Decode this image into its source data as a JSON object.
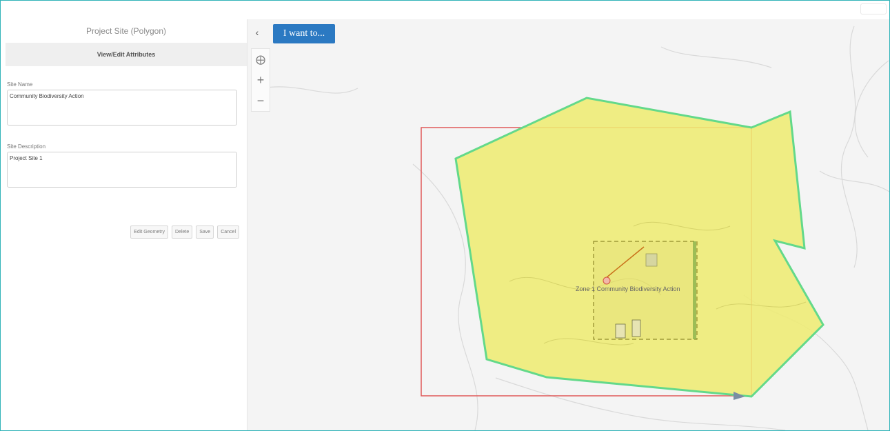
{
  "panel": {
    "title": "Project Site (Polygon)",
    "subheader": "View/Edit Attributes",
    "fields": [
      {
        "label": "Site Name",
        "value": "Community Biodiversity Action"
      },
      {
        "label": "Site Description",
        "value": "Project Site 1"
      }
    ],
    "buttons": {
      "edit_geometry": "Edit Geometry",
      "delete": "Delete",
      "save": "Save",
      "cancel": "Cancel"
    }
  },
  "map": {
    "i_want_to": "I want to...",
    "feature_label": "Zone 1 Community Biodiversity Action",
    "colors": {
      "polygon_fill": "#eeec73",
      "polygon_outline": "#63d98a",
      "extent_rect": "#e05a5a",
      "accent_button": "#2b79c2"
    }
  },
  "icons": {
    "collapse": "chevron-left-icon",
    "locate": "crosshair-locate-icon",
    "zoom_in": "plus-icon",
    "zoom_out": "minus-icon"
  }
}
